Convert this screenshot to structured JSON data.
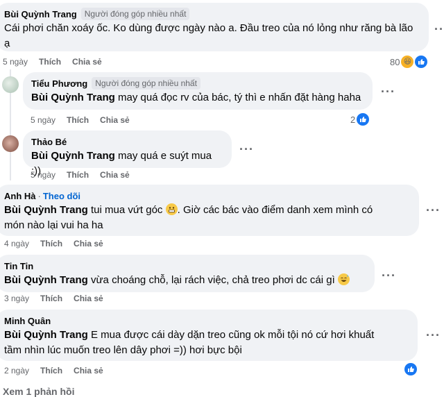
{
  "c1": {
    "author": "Bùi Quỳnh Trang",
    "badge": "Người đóng góp nhiều nhất",
    "line1": "Cái phơi chăn xoáy ốc. Ko dùng được ngày nào a. Đầu treo của nó lỏng như răng bà lão",
    "line2": "ạ",
    "time": "5 ngày",
    "like": "Thích",
    "share": "Chia sẻ",
    "reactions": "80"
  },
  "c2": {
    "author": "Tiểu Phương",
    "badge": "Người đóng góp nhiều nhất",
    "mention": "Bùi Quỳnh Trang",
    "text": " may quá đọc rv của bác, tý thì e nhấn đặt hàng haha",
    "time": "5 ngày",
    "like": "Thích",
    "share": "Chia sẻ",
    "reactions": "2"
  },
  "c3": {
    "author": "Thảo Bé",
    "mention": "Bùi Quỳnh Trang",
    "text": " may quá e suýt mua :))",
    "time": "5 ngày",
    "like": "Thích",
    "share": "Chia sẻ"
  },
  "c4": {
    "author": "Anh Hà",
    "sep": "·",
    "follow": "Theo dõi",
    "mention": "Bùi Quỳnh Trang",
    "text_a": " tui mua vứt góc ",
    "text_b": ". Giờ các bác vào điểm danh xem mình có",
    "line2": "món nào lại vui ha ha",
    "time": "4 ngày",
    "like": "Thích",
    "share": "Chia sẻ"
  },
  "c5": {
    "author": "Tin Tin",
    "mention": "Bùi Quỳnh Trang",
    "text": " vừa choáng chỗ, lại rách việc, chả treo phơi dc cái gì ",
    "time": "3 ngày",
    "like": "Thích",
    "share": "Chia sẻ"
  },
  "c6": {
    "author": "Minh Quân",
    "mention": "Bùi Quỳnh Trang",
    "text": " E mua được cái dày dặn treo cũng ok mỗi tội nó cứ hơi khuất",
    "line2": "tầm nhìn lúc muốn treo lên dây phơi =)) hơi bực bội",
    "time": "2 ngày",
    "like": "Thích",
    "share": "Chia sẻ"
  },
  "footer": "Xem 1 phản hồi",
  "colors": {
    "like_blue": "#1877f2",
    "bubble": "#f0f2f5",
    "meta": "#65676b",
    "link": "#0064d1"
  }
}
